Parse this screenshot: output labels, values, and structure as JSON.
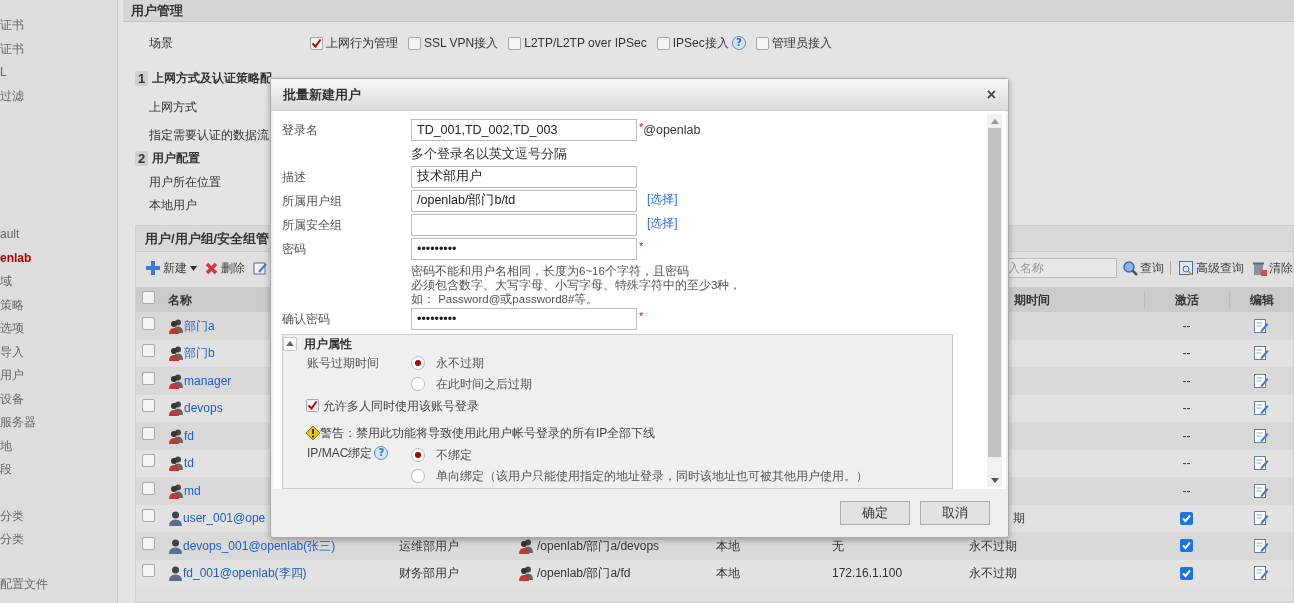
{
  "sidebar": {
    "groups": [
      {
        "items": [
          {
            "label": "证书",
            "selected": false
          },
          {
            "label": "证书",
            "selected": false
          },
          {
            "label": "L",
            "selected": false
          },
          {
            "label": "过滤",
            "selected": false
          }
        ]
      },
      {
        "items": [
          {
            "label": "ault",
            "selected": false
          },
          {
            "label": "enlab",
            "selected": true
          },
          {
            "label": "域",
            "selected": false
          },
          {
            "label": "策略",
            "selected": false
          },
          {
            "label": "选项",
            "selected": false
          },
          {
            "label": "导入",
            "selected": false
          },
          {
            "label": "用户",
            "selected": false
          },
          {
            "label": "设备",
            "selected": false
          },
          {
            "label": "服务器",
            "selected": false
          },
          {
            "label": "地",
            "selected": false
          },
          {
            "label": "段",
            "selected": false
          }
        ]
      },
      {
        "items": [
          {
            "label": "分类",
            "selected": false
          },
          {
            "label": "分类",
            "selected": false
          }
        ]
      },
      {
        "items": [
          {
            "label": "配置文件",
            "selected": false
          }
        ]
      }
    ]
  },
  "panel": {
    "title": "用户管理",
    "scene": {
      "label": "场景",
      "options": [
        {
          "label": "上网行为管理",
          "checked": true
        },
        {
          "label": "SSL VPN接入",
          "checked": false
        },
        {
          "label": "L2TP/L2TP over IPSec",
          "checked": false
        },
        {
          "label": "IPSec接入",
          "checked": false,
          "help": "?"
        },
        {
          "label": "管理员接入",
          "checked": false
        }
      ]
    },
    "sections": [
      {
        "number": "1",
        "title": "上网方式及认证策略配",
        "fields": [
          "上网方式",
          "指定需要认证的数据流"
        ]
      },
      {
        "number": "2",
        "title": "用户配置",
        "fields": [
          "用户所在位置",
          "本地用户"
        ]
      }
    ]
  },
  "user_panel": {
    "title": "用户/用户组/安全组管",
    "toolbar": [
      {
        "label": "新建",
        "kind": "add"
      },
      {
        "label": "删除",
        "kind": "delete"
      },
      {
        "kind": "edit"
      }
    ],
    "search": {
      "placeholder": "入名称"
    },
    "actions": [
      {
        "label": "查询",
        "kind": "search"
      },
      {
        "label": "高级查询",
        "kind": "advanced"
      },
      {
        "label": "清除",
        "kind": "clear"
      }
    ],
    "table": {
      "header": {
        "selected": false,
        "name": "名称",
        "expiry": "期时间",
        "active": "激活",
        "edit": "编辑"
      },
      "rows": [
        {
          "kind": "group",
          "selected": false,
          "name": "部门a",
          "active_text": "--"
        },
        {
          "kind": "group",
          "selected": false,
          "name": "部门b",
          "active_text": "--"
        },
        {
          "kind": "group",
          "selected": false,
          "name": "manager",
          "active_text": "--"
        },
        {
          "kind": "group",
          "selected": false,
          "name": "devops",
          "active_text": "--"
        },
        {
          "kind": "group",
          "selected": false,
          "name": "fd",
          "active_text": "--"
        },
        {
          "kind": "group",
          "selected": false,
          "name": "td",
          "active_text": "--"
        },
        {
          "kind": "group",
          "selected": false,
          "name": "md",
          "active_text": "--"
        },
        {
          "kind": "user",
          "selected": false,
          "name": "user_001@ope",
          "expiry": "期",
          "active": true
        },
        {
          "kind": "user",
          "selected": false,
          "name": "devops_001@openlab(张三)",
          "description": "运维部用户",
          "group": "/openlab/部门a/devops",
          "location": "本地",
          "binding": "无",
          "expiry": "永不过期",
          "active": true
        },
        {
          "kind": "user",
          "selected": false,
          "name": "fd_001@openlab(李四)",
          "description": "财务部用户",
          "group": "/openlab/部门a/fd",
          "location": "本地",
          "binding": "172.16.1.100",
          "expiry": "永不过期",
          "active": true
        }
      ]
    }
  },
  "dialog": {
    "title": "批量新建用户",
    "close": "×",
    "fields": [
      {
        "label": "登录名",
        "value": "TD_001,TD_002,TD_003",
        "required": "*",
        "suffix": "@openlab",
        "hint": [
          "多个登录名以英文逗号分隔"
        ]
      },
      {
        "label": "描述",
        "value": "技术部用户"
      },
      {
        "label": "所属用户组",
        "value": "/openlab/部门b/td",
        "link": "[选择]"
      },
      {
        "label": "所属安全组",
        "link": "[选择]"
      },
      {
        "label": "密码",
        "value": "•••••••••",
        "required": "*",
        "hint": [
          "密码不能和用户名相同，长度为6~16个字符，且密码",
          "必须包含数字、大写字母、小写字母、特殊字符中的至少3种，",
          "如： Password@或password8#等。"
        ]
      },
      {
        "label": "确认密码",
        "value": "•••••••••",
        "required": "*"
      }
    ],
    "attributes": {
      "title": "用户属性",
      "expanded": true,
      "expiry": {
        "label": "账号过期时间",
        "options": [
          {
            "label": "永不过期",
            "selected": true
          },
          {
            "label": "在此时间之后过期",
            "selected": false
          }
        ]
      },
      "multi_login": {
        "label": "允许多人同时使用该账号登录",
        "checked": true
      },
      "warning": "警告：禁用此功能将导致使用此用户帐号登录的所有IP全部下线",
      "binding": {
        "label": "IP/MAC绑定",
        "help": "?",
        "options": [
          {
            "label": "不绑定",
            "selected": true
          },
          {
            "label": "单向绑定（该用户只能使用指定的地址登录，同时该地址也可被其他用户使用。）",
            "selected": false
          }
        ]
      }
    },
    "buttons": [
      "确定",
      "取消"
    ]
  }
}
